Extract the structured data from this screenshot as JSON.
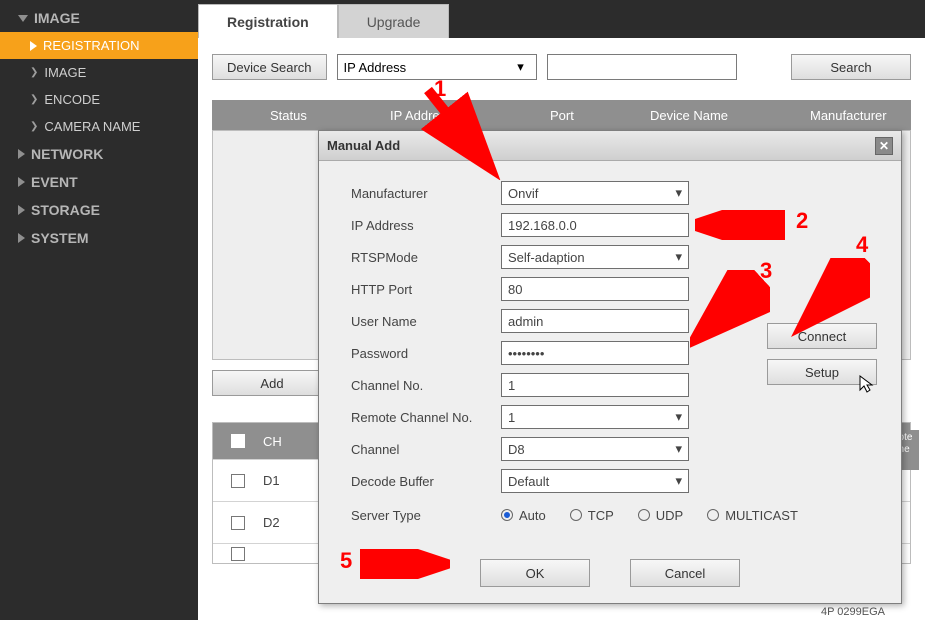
{
  "sidebar": {
    "groups": [
      {
        "label": "IMAGE",
        "expanded": true,
        "items": [
          {
            "label": "REGISTRATION",
            "active": true
          },
          {
            "label": "IMAGE"
          },
          {
            "label": "ENCODE"
          },
          {
            "label": "CAMERA NAME"
          }
        ]
      },
      {
        "label": "NETWORK"
      },
      {
        "label": "EVENT"
      },
      {
        "label": "STORAGE"
      },
      {
        "label": "SYSTEM"
      }
    ]
  },
  "tabs": [
    {
      "label": "Registration",
      "active": true
    },
    {
      "label": "Upgrade"
    }
  ],
  "search": {
    "device_search_btn": "Device Search",
    "filter_value": "IP Address",
    "text_value": "",
    "search_btn": "Search"
  },
  "table_head": [
    "Status",
    "IP Address",
    "Port",
    "Device Name",
    "Manufacturer"
  ],
  "add_btn": "Add",
  "ch_table": {
    "header": "CH",
    "rows": [
      "D1",
      "D2"
    ]
  },
  "modal": {
    "title": "Manual Add",
    "fields": {
      "manufacturer": {
        "label": "Manufacturer",
        "value": "Onvif",
        "dropdown": true
      },
      "ip": {
        "label": "IP Address",
        "value": "192.168.0.0"
      },
      "rtsp": {
        "label": "RTSPMode",
        "value": "Self-adaption",
        "dropdown": true
      },
      "http": {
        "label": "HTTP Port",
        "value": "80"
      },
      "user": {
        "label": "User Name",
        "value": "admin"
      },
      "pass": {
        "label": "Password",
        "value": "••••••••"
      },
      "chno": {
        "label": "Channel No.",
        "value": "1"
      },
      "rch": {
        "label": "Remote Channel No.",
        "value": "1",
        "dropdown": true
      },
      "channel": {
        "label": "Channel",
        "value": "D8",
        "dropdown": true
      },
      "decode": {
        "label": "Decode Buffer",
        "value": "Default",
        "dropdown": true
      },
      "server": {
        "label": "Server Type",
        "options": [
          "Auto",
          "TCP",
          "UDP",
          "MULTICAST"
        ],
        "value": "Auto"
      }
    },
    "connect": "Connect",
    "setup": "Setup",
    "ok": "OK",
    "cancel": "Cancel"
  },
  "annotations": {
    "n1": "1",
    "n2": "2",
    "n3": "3",
    "n4": "4",
    "n5": "5"
  },
  "footer_partial": "4P 0299EGA"
}
